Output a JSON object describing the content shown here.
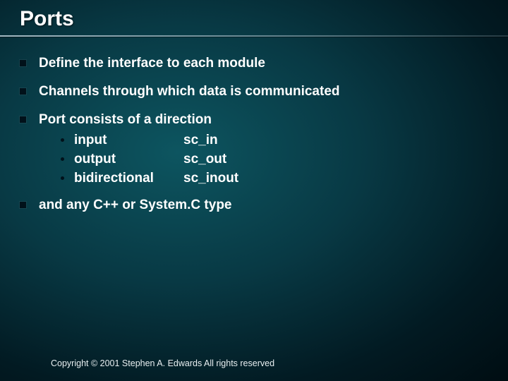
{
  "title": "Ports",
  "bullets": [
    {
      "text": "Define the interface to each module"
    },
    {
      "text": "Channels through which data is communicated"
    },
    {
      "text": "Port consists of a direction"
    }
  ],
  "sub_items": [
    {
      "left": "input",
      "right": "sc_in"
    },
    {
      "left": "output",
      "right": "sc_out"
    },
    {
      "left": "bidirectional",
      "right": "sc_inout"
    }
  ],
  "last_bullet": "and any C++ or System.C type",
  "footer": "Copyright © 2001 Stephen A. Edwards  All rights reserved"
}
